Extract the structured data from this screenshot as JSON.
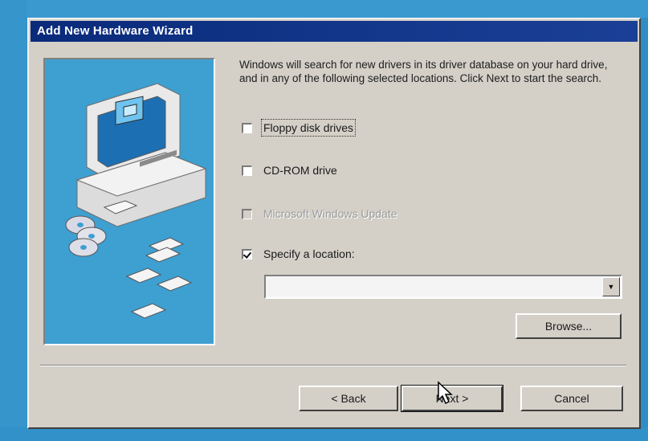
{
  "window": {
    "title": "Add New Hardware Wizard"
  },
  "intro": "Windows will search for new drivers in its driver database on your hard drive, and in any of the following selected locations. Click Next to start the search.",
  "options": [
    {
      "label": "Floppy disk drives",
      "checked": false,
      "enabled": true
    },
    {
      "label": "CD-ROM drive",
      "checked": false,
      "enabled": true
    },
    {
      "label": "Microsoft Windows Update",
      "checked": false,
      "enabled": false
    },
    {
      "label": "Specify a location:",
      "checked": true,
      "enabled": true
    }
  ],
  "location": {
    "value": ""
  },
  "buttons": {
    "browse": "Browse...",
    "back": "< Back",
    "next": "Next >",
    "cancel": "Cancel"
  },
  "colors": {
    "titlebar": "#0a2a7a",
    "dialog_face": "#d4d0c8",
    "art_panel": "#3e9fd1",
    "desktop": "#2f8fc4"
  },
  "icons": [
    "computer-illustration",
    "cd-disc-icon",
    "floppy-disk-icon",
    "mouse-cursor-icon",
    "dropdown-arrow-icon"
  ]
}
